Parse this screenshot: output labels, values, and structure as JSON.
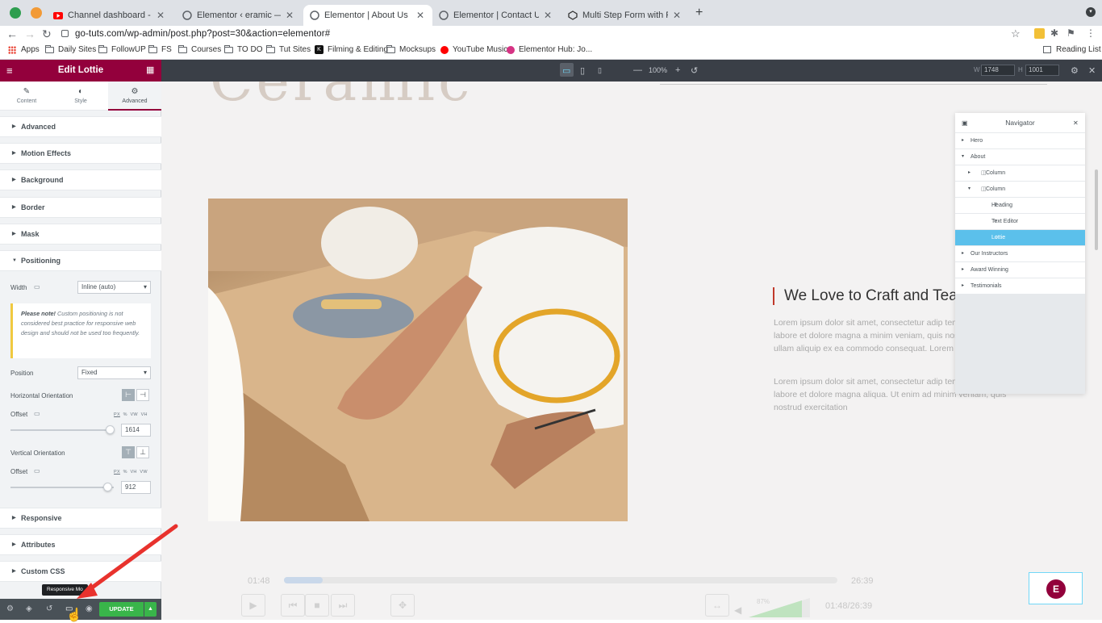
{
  "browser": {
    "tabs": [
      {
        "title": "Channel dashboard - YouTube",
        "active": false
      },
      {
        "title": "Elementor ‹ eramic — WordPress",
        "active": false
      },
      {
        "title": "Elementor | About Us",
        "active": true
      },
      {
        "title": "Elementor | Contact Us",
        "active": false
      },
      {
        "title": "Multi Step Form with Progress",
        "active": false
      }
    ],
    "url": "go-tuts.com/wp-admin/post.php?post=30&action=elementor#",
    "bookmarks": [
      "Apps",
      "Daily Sites",
      "FollowUP",
      "FS",
      "Courses",
      "TO DO",
      "Tut Sites",
      "Filming & Editing",
      "Mocksups",
      "YouTube Music",
      "Elementor Hub: Jo..."
    ],
    "reading_list": "Reading List"
  },
  "editor_top": {
    "zoom": "100%",
    "width_label": "W",
    "width_value": "1748",
    "height_label": "H",
    "height_value": "1001"
  },
  "panel": {
    "title": "Edit Lottie",
    "tabs": [
      {
        "label": "Content",
        "icon": "pencil-icon"
      },
      {
        "label": "Style",
        "icon": "half-circle-icon"
      },
      {
        "label": "Advanced",
        "icon": "gear-icon"
      }
    ],
    "sections_top": [
      "Advanced",
      "Motion Effects",
      "Background",
      "Border",
      "Mask"
    ],
    "positioning": {
      "title": "Positioning",
      "width_label": "Width",
      "width_value": "Inline (auto)",
      "note_bold": "Please note!",
      "note_text": " Custom positioning is not considered best practice for responsive web design and should not be used too frequently.",
      "position_label": "Position",
      "position_value": "Fixed",
      "h_orientation_label": "Horizontal Orientation",
      "h_offset_label": "Offset",
      "h_units": [
        "PX",
        "%",
        "VW",
        "VH"
      ],
      "h_offset_value": "1614",
      "h_offset_fraction": 0.92,
      "v_orientation_label": "Vertical Orientation",
      "v_offset_label": "Offset",
      "v_units": [
        "PX",
        "%",
        "VH",
        "VW"
      ],
      "v_offset_value": "912",
      "v_offset_fraction": 0.9
    },
    "sections_bottom": [
      "Responsive",
      "Attributes",
      "Custom CSS"
    ],
    "footer": {
      "update_label": "UPDATE",
      "tooltip": "Responsive Mo"
    }
  },
  "canvas": {
    "big_text": "Ceramic",
    "heading": "We Love to Craft and Tea",
    "para1": "Lorem ipsum dolor sit amet, consectetur adip tempor incididunt ut labore et dolore magna a minim veniam, quis nostrud exercitation ullam aliquip ex ea commodo consequat. Lorem ips",
    "para2": "Lorem ipsum dolor sit amet, consectetur adip tempor incididunt ut labore et dolore magna aliqua. Ut enim ad minim veniam, quis nostrud exercitation",
    "player": {
      "elapsed": "01:48",
      "total": "26:39",
      "volume": "87%",
      "time_display": "01:48/26:39",
      "progress_fraction": 0.07
    }
  },
  "navigator": {
    "title": "Navigator",
    "items": [
      {
        "label": "Hero",
        "depth": 0,
        "arrow": "▸"
      },
      {
        "label": "About",
        "depth": 0,
        "arrow": "▾"
      },
      {
        "label": "Column",
        "depth": 1,
        "arrow": "▸"
      },
      {
        "label": "Column",
        "depth": 1,
        "arrow": "▾"
      },
      {
        "label": "Heading",
        "depth": 2,
        "arrow": ""
      },
      {
        "label": "Text Editor",
        "depth": 2,
        "arrow": ""
      },
      {
        "label": "Lottie",
        "depth": 2,
        "arrow": "",
        "active": true
      },
      {
        "label": "Our Instructors",
        "depth": 0,
        "arrow": "▸"
      },
      {
        "label": "Award Winning",
        "depth": 0,
        "arrow": "▸"
      },
      {
        "label": "Testimonials",
        "depth": 0,
        "arrow": "▸"
      }
    ]
  },
  "colors": {
    "panel_header": "#93003c",
    "update_green": "#39b54a",
    "navigator_active": "#5bc0eb",
    "annotation_arrow": "#e8322d"
  }
}
